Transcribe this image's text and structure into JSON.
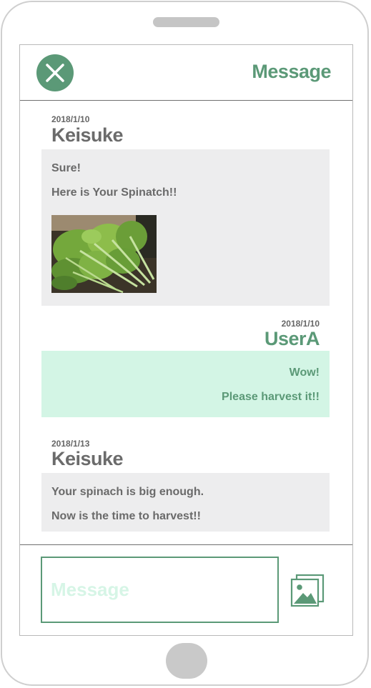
{
  "header": {
    "title": "Message"
  },
  "messages": [
    {
      "date": "2018/1/10",
      "sender": "Keisuke",
      "lines": [
        "Sure!",
        "Here is Your Spinatch!!"
      ]
    },
    {
      "date": "2018/1/10",
      "sender": "UserA",
      "lines": [
        "Wow!",
        "Please harvest it!!"
      ]
    },
    {
      "date": "2018/1/13",
      "sender": "Keisuke",
      "lines": [
        "Your spinach is big enough.",
        "Now is the time to harvest!!"
      ]
    }
  ],
  "composer": {
    "placeholder": "Message",
    "image_icon": "image-gallery-icon"
  },
  "colors": {
    "accent": "#5b9977",
    "incoming_bubble": "#ededee",
    "outgoing_bubble": "#d3f5e5"
  }
}
